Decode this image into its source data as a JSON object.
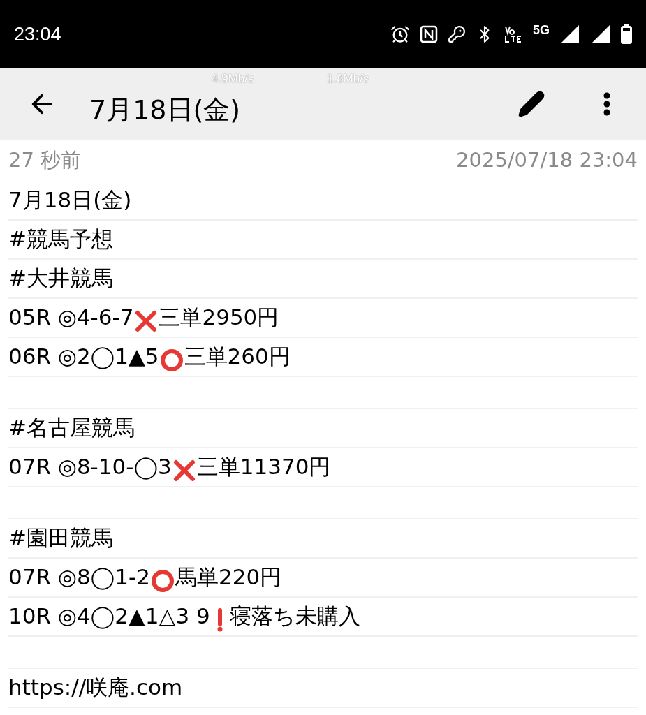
{
  "status_bar": {
    "time": "23:04",
    "network": "5G"
  },
  "speed_overlay": [
    "4.9Mb/s",
    "1.8Mb/s"
  ],
  "app_bar": {
    "title": "7月18日(金)"
  },
  "meta": {
    "ago": "27 秒前",
    "timestamp": "2025/07/18 23:04"
  },
  "lines": [
    {
      "kind": "text",
      "parts": [
        {
          "kind": "text",
          "text": "7月18日(金)"
        }
      ]
    },
    {
      "kind": "text",
      "parts": [
        {
          "kind": "text",
          "text": "#競馬予想"
        }
      ]
    },
    {
      "kind": "text",
      "parts": [
        {
          "kind": "text",
          "text": "#大井競馬"
        }
      ]
    },
    {
      "kind": "text",
      "parts": [
        {
          "kind": "text",
          "text": "05R ◎4-6-7"
        },
        {
          "kind": "cross"
        },
        {
          "kind": "text",
          "text": "三単2950円"
        }
      ]
    },
    {
      "kind": "text",
      "parts": [
        {
          "kind": "text",
          "text": "06R ◎2◯1▲5"
        },
        {
          "kind": "circle"
        },
        {
          "kind": "text",
          "text": "三単260円"
        }
      ]
    },
    {
      "kind": "blank"
    },
    {
      "kind": "text",
      "parts": [
        {
          "kind": "text",
          "text": "#名古屋競馬"
        }
      ]
    },
    {
      "kind": "text",
      "parts": [
        {
          "kind": "text",
          "text": "07R ◎8-10-◯3"
        },
        {
          "kind": "cross"
        },
        {
          "kind": "text",
          "text": "三単11370円"
        }
      ]
    },
    {
      "kind": "blank"
    },
    {
      "kind": "text",
      "parts": [
        {
          "kind": "text",
          "text": "#園田競馬"
        }
      ]
    },
    {
      "kind": "text",
      "parts": [
        {
          "kind": "text",
          "text": "07R ◎8◯1-2"
        },
        {
          "kind": "circle"
        },
        {
          "kind": "text",
          "text": "馬単220円"
        }
      ]
    },
    {
      "kind": "text",
      "parts": [
        {
          "kind": "text",
          "text": "10R ◎4◯2▲1△3 9"
        },
        {
          "kind": "exclaim"
        },
        {
          "kind": "text",
          "text": "寝落ち未購入"
        }
      ]
    },
    {
      "kind": "blank"
    },
    {
      "kind": "text",
      "parts": [
        {
          "kind": "link",
          "text": "https://咲庵.com"
        }
      ]
    }
  ]
}
